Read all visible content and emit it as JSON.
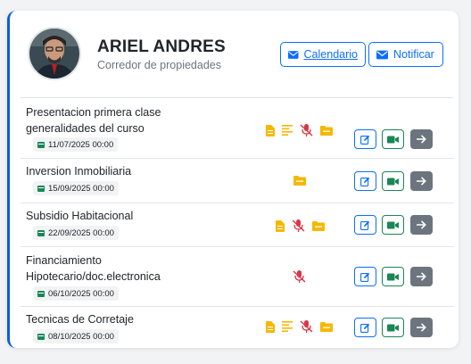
{
  "profile": {
    "name": "ARIEL ANDRES",
    "role": "Corredor de propiedades"
  },
  "header_buttons": {
    "calendar_label": "Calendario",
    "notify_label": "Notificar"
  },
  "colors": {
    "primary": "#0d6efd",
    "success": "#198754",
    "secondary": "#6c757d",
    "resource_yellow": "#f5b800",
    "mic_red": "#dc3545"
  },
  "courses": [
    {
      "title": "Presentacion primera clase generalidades del curso",
      "date": "11/07/2025 00:00",
      "resources": [
        "file-icon",
        "align-left-icon",
        "mic-off-icon",
        "folder-icon"
      ]
    },
    {
      "title": "Inversion Inmobiliaria",
      "date": "15/09/2025 00:00",
      "resources": [
        "folder-icon"
      ]
    },
    {
      "title": "Subsidio Habitacional",
      "date": "22/09/2025 00:00",
      "resources": [
        "file-icon",
        "mic-off-icon",
        "folder-icon"
      ]
    },
    {
      "title": "Financiamiento Hipotecario/doc.electronica",
      "date": "06/10/2025 00:00",
      "resources": [
        "mic-off-icon"
      ]
    },
    {
      "title": "Tecnicas de Corretaje",
      "date": "08/10/2025 00:00",
      "resources": [
        "file-icon",
        "align-left-icon",
        "mic-off-icon",
        "folder-icon"
      ]
    }
  ],
  "row_actions": [
    "edit-icon",
    "video-icon",
    "arrow-right-icon"
  ]
}
